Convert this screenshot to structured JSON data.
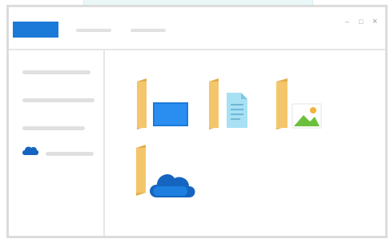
{
  "window": {
    "title_tab": "",
    "controls": {
      "minimize_glyph": "–",
      "maximize_glyph": "□",
      "close_glyph": "×"
    }
  },
  "sidebar": {
    "items": [
      {
        "label": "",
        "icon": null
      },
      {
        "label": "",
        "icon": null
      },
      {
        "label": "",
        "icon": null
      },
      {
        "label": "",
        "icon": "onedrive-cloud-icon"
      }
    ]
  },
  "main": {
    "folders": [
      {
        "name": "",
        "icon": "desktop-folder-icon"
      },
      {
        "name": "",
        "icon": "documents-folder-icon"
      },
      {
        "name": "",
        "icon": "pictures-folder-icon"
      },
      {
        "name": "",
        "icon": "onedrive-folder-icon"
      }
    ]
  },
  "colors": {
    "accent": "#1b7ad8",
    "folder": "#f4c66b",
    "folder_dark": "#e2ae4c",
    "cloud": "#1565c0",
    "document": "#a8e0f4",
    "picture_green": "#6cbf3c"
  }
}
